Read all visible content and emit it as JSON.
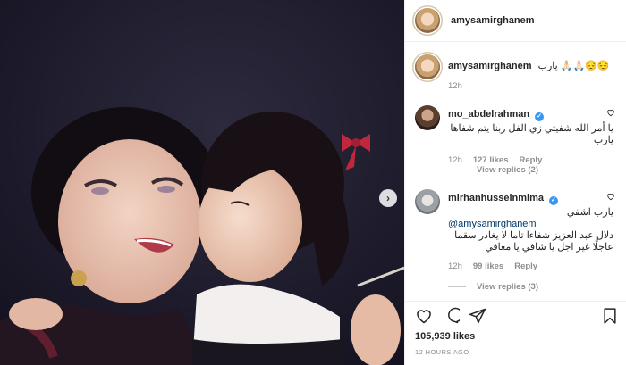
{
  "post": {
    "username": "amysamirghanem",
    "caption_username": "amysamirghanem",
    "caption_text": "يارب 🙏🏻🙏🏻😔😔",
    "caption_age": "12h",
    "like_count": "105,939 likes",
    "posted_ago": "12 HOURS AGO"
  },
  "comments": [
    {
      "username": "mo_abdelrahman",
      "verified": true,
      "text": "يا أمر الله شفيتي زي الفل ربنا يتم شفاها يارب",
      "age": "12h",
      "likes": "127 likes",
      "reply_label": "Reply",
      "view_replies": "View replies (2)"
    },
    {
      "username": "mirhanhusseinmima",
      "verified": true,
      "text_line1": "يارب اشفي",
      "mention": "@amysamirghanem",
      "text_rest": "دلال عبد العزيز شفاءا تاما لا يغادر سقما عاجلًا غير اجل يا شافي يا معافي",
      "age": "12h",
      "likes": "99 likes",
      "reply_label": "Reply",
      "view_replies": "View replies (3)"
    }
  ],
  "icons": {
    "like": "heart-icon",
    "comment": "comment-icon",
    "share": "share-icon",
    "save": "bookmark-icon",
    "next": "chevron-right-icon"
  },
  "colors": {
    "verified": "#3897f0",
    "muted_text": "#8e8e8e",
    "text": "#262626",
    "mention": "#00376b"
  }
}
